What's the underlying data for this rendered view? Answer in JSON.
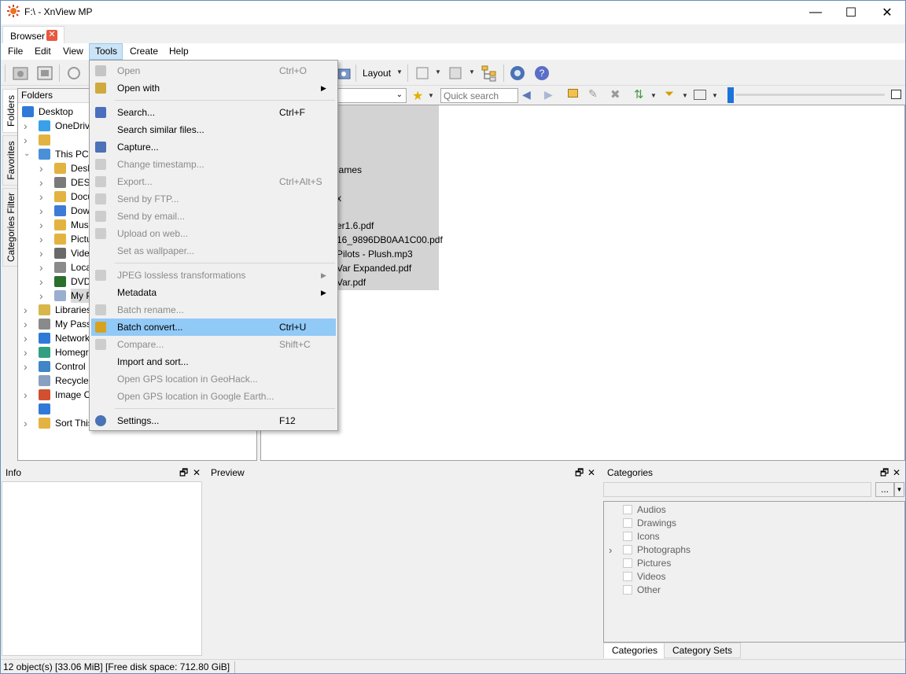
{
  "window": {
    "title": "F:\\ - XnView MP",
    "minimize": "—",
    "maximize": "☐",
    "close": "✕"
  },
  "doc_tab": {
    "label": "Browser",
    "close": "✕"
  },
  "menubar": [
    "File",
    "Edit",
    "View",
    "Tools",
    "Create",
    "Help"
  ],
  "toolbar": {
    "layout_label": "Layout"
  },
  "side_tabs": [
    "Folders",
    "Favorites",
    "Categories Filter"
  ],
  "folders": {
    "header": "Folders",
    "items": [
      {
        "label": "Desktop",
        "arrow": "",
        "indent": 0
      },
      {
        "label": "OneDriv",
        "arrow": ">",
        "indent": 1
      },
      {
        "label": "",
        "arrow": ">",
        "indent": 1
      },
      {
        "label": "This PC",
        "arrow": "v",
        "indent": 1
      },
      {
        "label": "Desk",
        "arrow": ">",
        "indent": 2
      },
      {
        "label": "DESK",
        "arrow": ">",
        "indent": 2
      },
      {
        "label": "Docu",
        "arrow": ">",
        "indent": 2
      },
      {
        "label": "Dow",
        "arrow": ">",
        "indent": 2
      },
      {
        "label": "Mus",
        "arrow": ">",
        "indent": 2
      },
      {
        "label": "Pictu",
        "arrow": ">",
        "indent": 2
      },
      {
        "label": "Vide",
        "arrow": ">",
        "indent": 2
      },
      {
        "label": "Loca",
        "arrow": ">",
        "indent": 2
      },
      {
        "label": "DVD",
        "arrow": ">",
        "indent": 2
      },
      {
        "label": "My P",
        "arrow": ">",
        "indent": 2
      },
      {
        "label": "Libraries",
        "arrow": ">",
        "indent": 1
      },
      {
        "label": "My Pass",
        "arrow": ">",
        "indent": 1
      },
      {
        "label": "Network",
        "arrow": ">",
        "indent": 1
      },
      {
        "label": "Homegr",
        "arrow": ">",
        "indent": 1
      },
      {
        "label": "Control",
        "arrow": ">",
        "indent": 1
      },
      {
        "label": "Recycle",
        "arrow": "",
        "indent": 1
      },
      {
        "label": "Image C",
        "arrow": ">",
        "indent": 1
      },
      {
        "label": "",
        "arrow": "",
        "indent": 1
      },
      {
        "label": "Sort This",
        "arrow": ">",
        "indent": 1
      }
    ]
  },
  "filter": {
    "search_placeholder": "Quick search"
  },
  "files": [
    {
      "name": "iames",
      "offset": 0
    },
    {
      "name": "x",
      "offset": 0
    },
    {
      "name": "er1.6.pdf",
      "offset": 0
    },
    {
      "name": "16_9896DB0AA1C00.pdf",
      "offset": 0
    },
    {
      "name": "Pilots - Plush.mp3",
      "offset": 0
    },
    {
      "name": "Var Expanded.pdf",
      "offset": 0
    },
    {
      "name": "Var.pdf",
      "offset": 0
    }
  ],
  "tools_menu": [
    {
      "label": "Open",
      "shortcut": "Ctrl+O",
      "disabled": true,
      "icon": "open-icon"
    },
    {
      "label": "Open with",
      "shortcut": "",
      "disabled": false,
      "submenu": true,
      "icon": "open-with-icon"
    },
    {
      "sep": true
    },
    {
      "label": "Search...",
      "shortcut": "Ctrl+F",
      "disabled": false,
      "icon": "binoculars-icon"
    },
    {
      "label": "Search similar files...",
      "shortcut": "",
      "disabled": false
    },
    {
      "label": "Capture...",
      "shortcut": "",
      "disabled": false,
      "icon": "camera-icon"
    },
    {
      "label": "Change timestamp...",
      "shortcut": "",
      "disabled": true,
      "icon": "timestamp-icon"
    },
    {
      "label": "Export...",
      "shortcut": "Ctrl+Alt+S",
      "disabled": true,
      "icon": "export-icon"
    },
    {
      "label": "Send by FTP...",
      "shortcut": "",
      "disabled": true,
      "icon": "ftp-icon"
    },
    {
      "label": "Send by email...",
      "shortcut": "",
      "disabled": true,
      "icon": "email-icon"
    },
    {
      "label": "Upload on web...",
      "shortcut": "",
      "disabled": true,
      "icon": "upload-icon"
    },
    {
      "label": "Set as wallpaper...",
      "shortcut": "",
      "disabled": true
    },
    {
      "sep": true
    },
    {
      "label": "JPEG lossless transformations",
      "shortcut": "",
      "disabled": true,
      "submenu": true,
      "icon": "jpeg-icon"
    },
    {
      "label": "Metadata",
      "shortcut": "",
      "disabled": false,
      "submenu": true
    },
    {
      "label": "Batch rename...",
      "shortcut": "",
      "disabled": true,
      "icon": "rename-icon"
    },
    {
      "label": "Batch convert...",
      "shortcut": "Ctrl+U",
      "disabled": false,
      "highlight": true,
      "icon": "batch-convert-icon"
    },
    {
      "label": "Compare...",
      "shortcut": "Shift+C",
      "disabled": true,
      "icon": "compare-icon"
    },
    {
      "label": "Import and sort...",
      "shortcut": "",
      "disabled": false
    },
    {
      "label": "Open GPS location in GeoHack...",
      "shortcut": "",
      "disabled": true
    },
    {
      "label": "Open GPS location in Google Earth...",
      "shortcut": "",
      "disabled": true
    },
    {
      "sep": true
    },
    {
      "label": "Settings...",
      "shortcut": "F12",
      "disabled": false,
      "icon": "gear-icon"
    }
  ],
  "panels": {
    "info": "Info",
    "preview": "Preview",
    "categories": "Categories",
    "float": "🗗",
    "close": "✕",
    "more_button": "..."
  },
  "categories": [
    {
      "label": "Audios",
      "expand": false
    },
    {
      "label": "Drawings",
      "expand": false
    },
    {
      "label": "Icons",
      "expand": false
    },
    {
      "label": "Photographs",
      "expand": true
    },
    {
      "label": "Pictures",
      "expand": false
    },
    {
      "label": "Videos",
      "expand": false
    },
    {
      "label": "Other",
      "expand": false
    }
  ],
  "category_tabs": [
    "Categories",
    "Category Sets"
  ],
  "status": "12 object(s) [33.06 MiB] [Free disk space: 712.80 GiB]",
  "colors": {
    "accent": "#91c9f7",
    "menu_open": "#cce4f7",
    "selection": "#d3d3d3"
  }
}
